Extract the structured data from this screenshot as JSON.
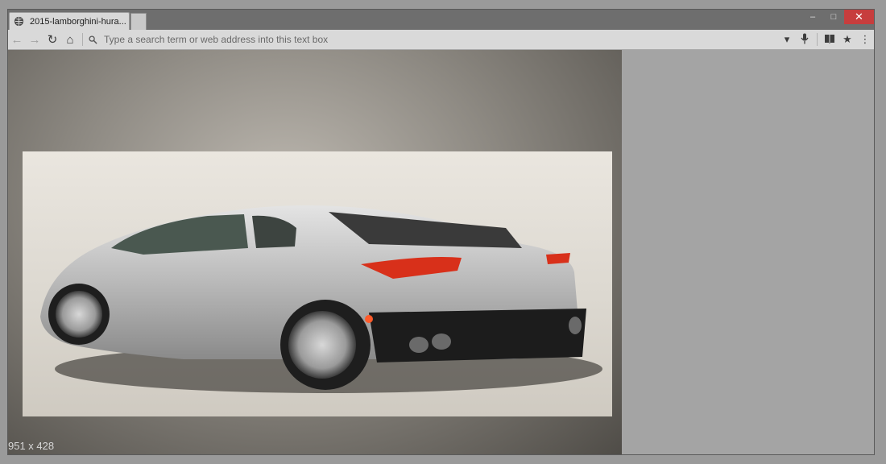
{
  "tab": {
    "title": "2015-lamborghini-hura..."
  },
  "window_controls": {
    "minimize": "–",
    "maximize": "□",
    "close": "✕"
  },
  "toolbar": {
    "back_icon": "←",
    "forward_icon": "→",
    "reload_icon": "↻",
    "home_icon": "⌂",
    "search_placeholder": "Type a search term or web address into this text box",
    "dropdown_icon": "▾",
    "bookmark_icon": "★",
    "menu_icon": "⋮"
  },
  "image": {
    "dimensions": "951 x 428"
  }
}
